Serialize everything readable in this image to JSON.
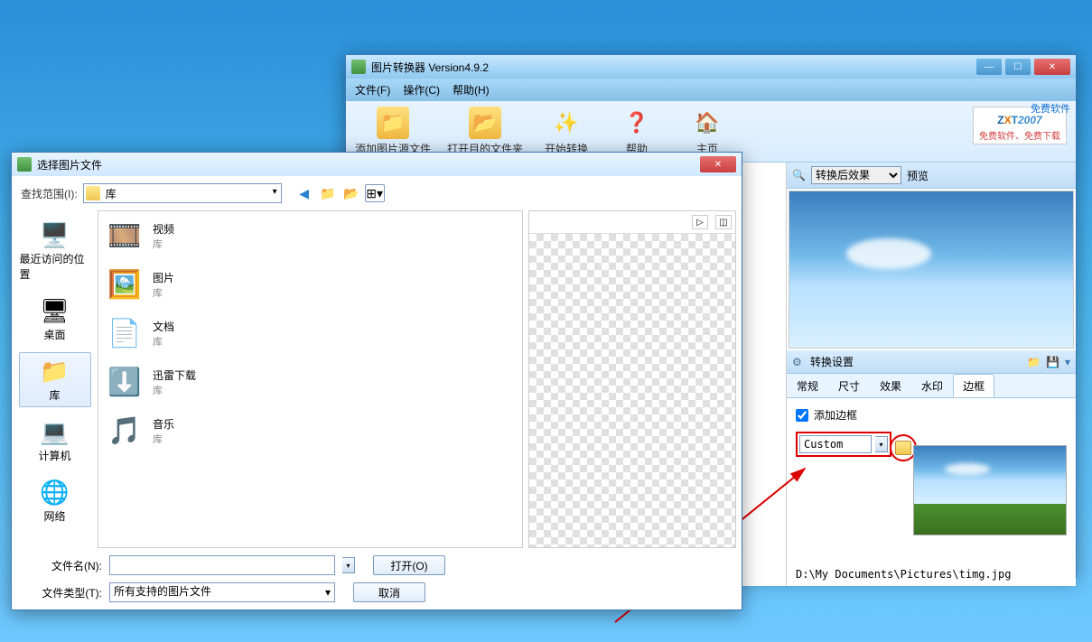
{
  "desktop": {},
  "mainwin": {
    "title": "图片转换器 Version4.9.2",
    "menu": {
      "file": "文件(F)",
      "op": "操作(C)",
      "help": "帮助(H)"
    },
    "toolbar": {
      "add": "添加图片源文件",
      "open": "打开目的文件夹",
      "convert": "开始转换",
      "help": "帮助",
      "home": "主页"
    },
    "free_label": "免费软件",
    "logo": {
      "z": "Z",
      "x": "X",
      "t": "T",
      "yr": "2007",
      "tag": "免费软件、免费下载"
    },
    "right": {
      "effect_combo": "转换后效果",
      "preview": "预览",
      "settings": "转换设置",
      "tabs": {
        "general": "常规",
        "size": "尺寸",
        "effect": "效果",
        "water": "水印",
        "border": "边框"
      },
      "add_border": "添加边框",
      "border_combo": "Custom",
      "path": "D:\\My Documents\\Pictures\\timg.jpg"
    }
  },
  "dialog": {
    "title": "选择图片文件",
    "lookin": "查找范围(I):",
    "lookin_value": "库",
    "sidebar": [
      {
        "label": "最近访问的位置",
        "key": "recent"
      },
      {
        "label": "桌面",
        "key": "desktop"
      },
      {
        "label": "库",
        "key": "libraries",
        "selected": true
      },
      {
        "label": "计算机",
        "key": "computer"
      },
      {
        "label": "网络",
        "key": "network"
      }
    ],
    "items": [
      {
        "name": "视频",
        "sub": "库",
        "kind": "video"
      },
      {
        "name": "图片",
        "sub": "库",
        "kind": "pictures"
      },
      {
        "name": "文档",
        "sub": "库",
        "kind": "documents"
      },
      {
        "name": "迅雷下载",
        "sub": "库",
        "kind": "download"
      },
      {
        "name": "音乐",
        "sub": "库",
        "kind": "music"
      }
    ],
    "filename_lbl": "文件名(N):",
    "filetype_lbl": "文件类型(T):",
    "filetype_value": "所有支持的图片文件",
    "open": "打开(O)",
    "cancel": "取消"
  }
}
